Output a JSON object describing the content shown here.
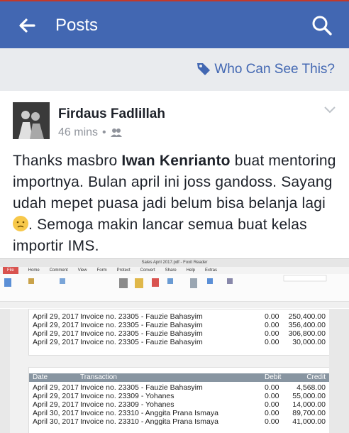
{
  "appbar": {
    "title": "Posts"
  },
  "privacy": {
    "label": "Who Can See This?"
  },
  "post": {
    "author": "Firdaus Fadlillah",
    "time": "46 mins",
    "text_part1": "Thanks masbro ",
    "mention": "Iwan Kenrianto",
    "text_part2": " buat mentoring importnya. Bulan april ini joss gandoss. Sayang udah mepet puasa jadi belum bisa belanja lagi ",
    "text_part3": ". Semoga makin lancar semua buat kelas importir IMS."
  },
  "screenshot": {
    "window_title": "Sales April 2017.pdf - Foxit Reader",
    "menu": [
      "File",
      "Home",
      "Comment",
      "View",
      "Form",
      "Protect",
      "Convert",
      "Share",
      "Help",
      "Extras"
    ],
    "page1_rows": [
      {
        "date": "April 29, 2017",
        "txn": "Invoice no. 23305 - Fauzie Bahasyim",
        "debit": "0.00",
        "credit": "250,400.00"
      },
      {
        "date": "April 29, 2017",
        "txn": "Invoice no. 23305 - Fauzie Bahasyim",
        "debit": "0.00",
        "credit": "356,400.00"
      },
      {
        "date": "April 29, 2017",
        "txn": "Invoice no. 23305 - Fauzie Bahasyim",
        "debit": "0.00",
        "credit": "306,800.00"
      },
      {
        "date": "April 29, 2017",
        "txn": "Invoice no. 23305 - Fauzie Bahasyim",
        "debit": "0.00",
        "credit": "30,000.00"
      }
    ],
    "header": {
      "date": "Date",
      "txn": "Transaction",
      "debit": "Debit",
      "credit": "Credit"
    },
    "page2_rows": [
      {
        "date": "April 29, 2017",
        "txn": "Invoice no. 23305 - Fauzie Bahasyim",
        "debit": "0.00",
        "credit": "4,568.00"
      },
      {
        "date": "April 29, 2017",
        "txn": "Invoice no. 23309 - Yohanes",
        "debit": "0.00",
        "credit": "55,000.00"
      },
      {
        "date": "April 29, 2017",
        "txn": "Invoice no. 23309 - Yohanes",
        "debit": "0.00",
        "credit": "14,000.00"
      },
      {
        "date": "April 30, 2017",
        "txn": "Invoice no. 23310 - Anggita Prana Ismaya",
        "debit": "0.00",
        "credit": "89,700.00"
      },
      {
        "date": "April 30, 2017",
        "txn": "Invoice no. 23310 - Anggita Prana Ismaya",
        "debit": "0.00",
        "credit": "41,000.00"
      }
    ]
  }
}
